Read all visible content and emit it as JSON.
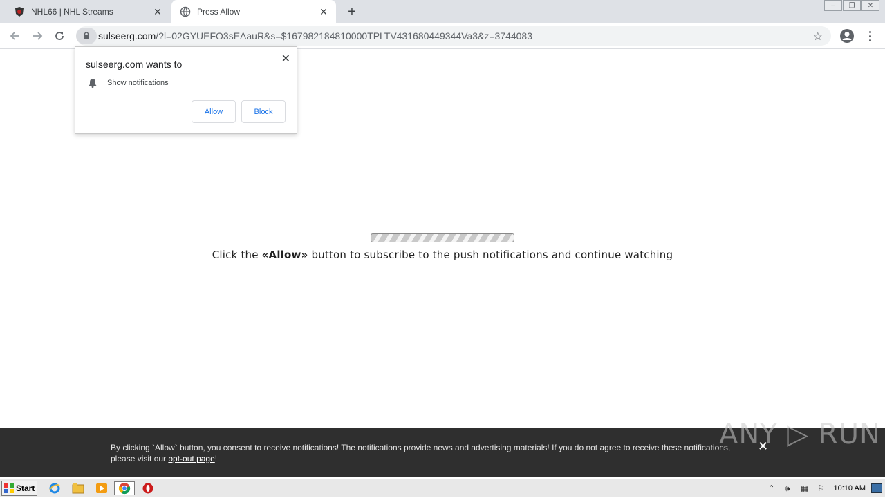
{
  "browser": {
    "tabs": [
      {
        "title": "NHL66 | NHL Streams",
        "active": false,
        "icon": "nhl-shield-icon"
      },
      {
        "title": "Press Allow",
        "active": true,
        "icon": "globe-icon"
      }
    ],
    "new_tab_label": "+",
    "url_host": "sulseerg.com",
    "url_rest": "/?l=02GYUEFO3sEAauR&s=$167982184810000TPLTV431680449344Va3&z=3744083"
  },
  "popup": {
    "title": "sulseerg.com wants to",
    "permission": "Show notifications",
    "allow_label": "Allow",
    "block_label": "Block"
  },
  "page": {
    "message_before": "Click the ",
    "message_bold": "«Allow»",
    "message_after": " button to subscribe to the push notifications and continue watching"
  },
  "banner": {
    "text": "By clicking `Allow` button, you consent to receive notifications! The notifications provide news and advertising materials! If you do not agree to receive these notifications, please visit our ",
    "link_text": "opt-out page",
    "text_end": "!",
    "close_label": "✕"
  },
  "watermark": "ANY ▷ RUN",
  "taskbar": {
    "start_label": "Start",
    "clock": "10:10 AM"
  }
}
